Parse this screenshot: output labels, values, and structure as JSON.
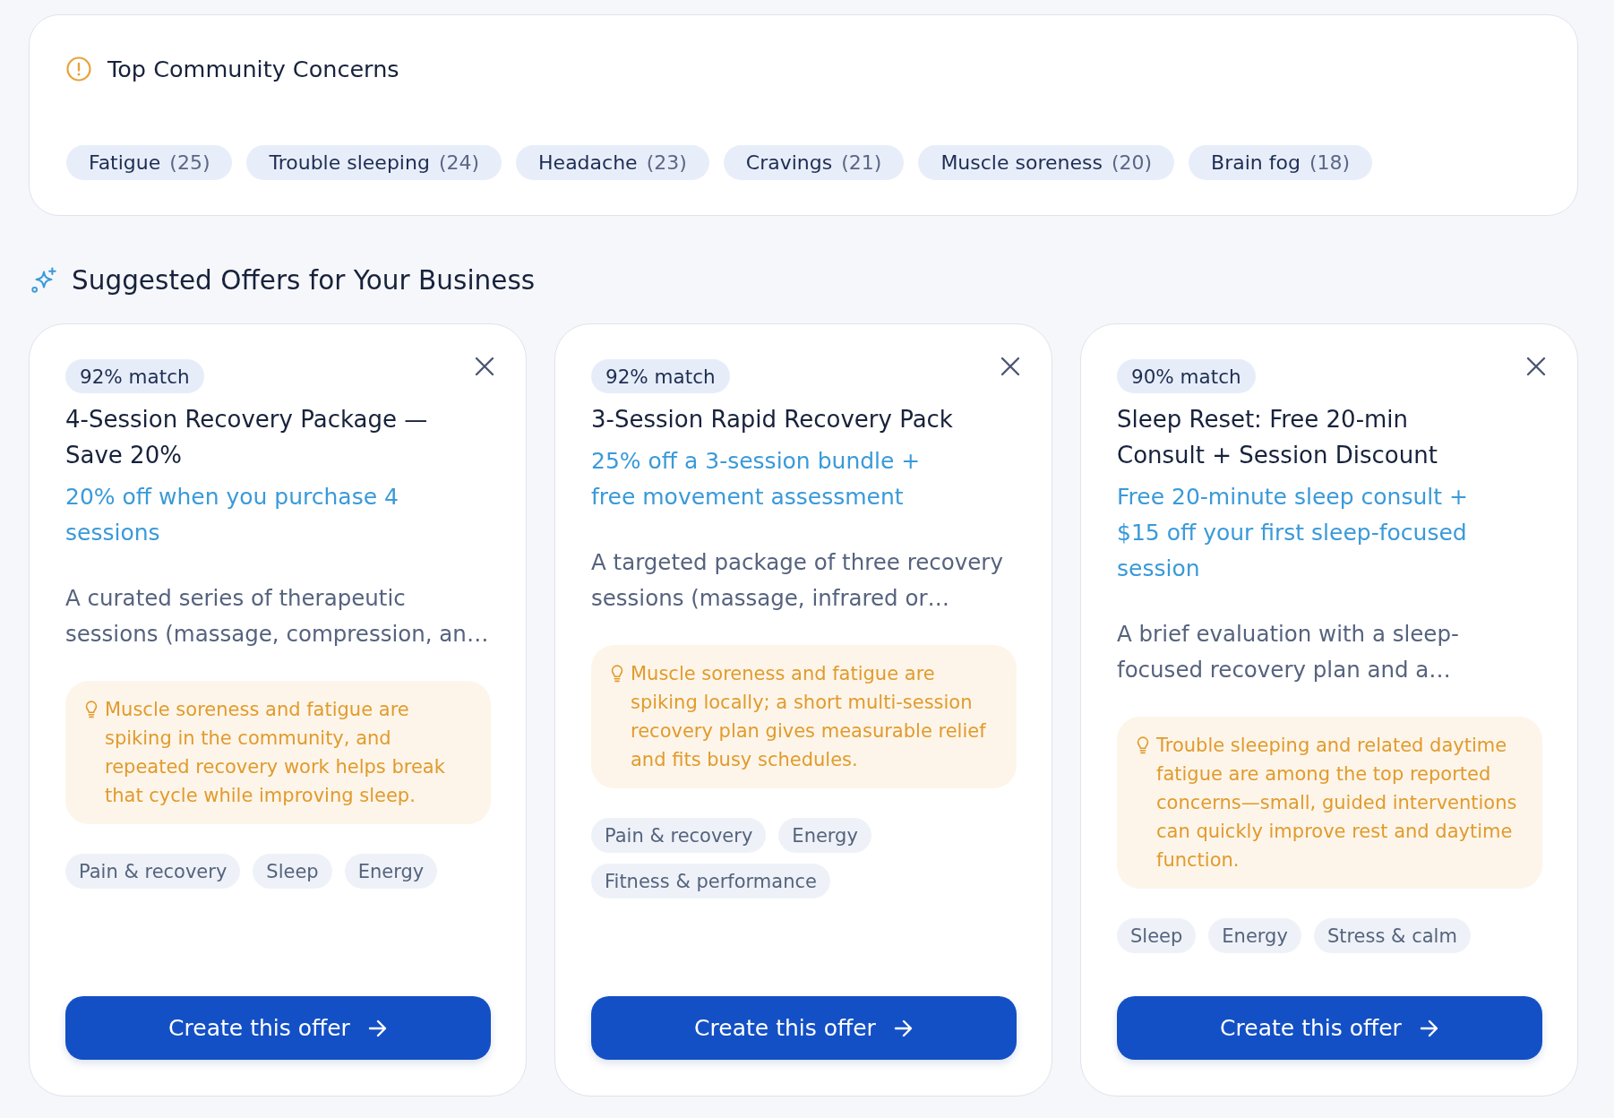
{
  "concerns": {
    "title": "Top Community Concerns",
    "items": [
      {
        "label": "Fatigue",
        "count": "(25)"
      },
      {
        "label": "Trouble sleeping",
        "count": "(24)"
      },
      {
        "label": "Headache",
        "count": "(23)"
      },
      {
        "label": "Cravings",
        "count": "(21)"
      },
      {
        "label": "Muscle soreness",
        "count": "(20)"
      },
      {
        "label": "Brain fog",
        "count": "(18)"
      }
    ]
  },
  "offers_section": {
    "title": "Suggested Offers for Your Business"
  },
  "offers": [
    {
      "match": "92% match",
      "title": "4-Session Recovery Package — Save 20%",
      "subtitle": "20% off when you purchase 4 sessions",
      "description": "A curated series of therapeutic sessions (massage, compression, an…",
      "insight": "Muscle soreness and fatigue are spiking in the community, and repeated recovery work helps break that cycle while improving sleep.",
      "tags": [
        "Pain & recovery",
        "Sleep",
        "Energy"
      ],
      "button": "Create this offer"
    },
    {
      "match": "92% match",
      "title": "3-Session Rapid Recovery Pack",
      "subtitle": "25% off a 3-session bundle + free movement assessment",
      "description": "A targeted package of three recovery sessions (massage, infrared or…",
      "insight": "Muscle soreness and fatigue are spiking locally; a short multi-session recovery plan gives measurable relief and fits busy schedules.",
      "tags": [
        "Pain & recovery",
        "Energy",
        "Fitness & performance"
      ],
      "button": "Create this offer"
    },
    {
      "match": "90% match",
      "title": "Sleep Reset: Free 20-min Consult + Session Discount",
      "subtitle": "Free 20-minute sleep consult + $15 off your first sleep-focused session",
      "description": "A brief evaluation with a sleep-focused recovery plan and a…",
      "insight": "Trouble sleeping and related daytime fatigue are among the top reported concerns—small, guided interventions can quickly improve rest and daytime function.",
      "tags": [
        "Sleep",
        "Energy",
        "Stress & calm"
      ],
      "button": "Create this offer"
    }
  ]
}
